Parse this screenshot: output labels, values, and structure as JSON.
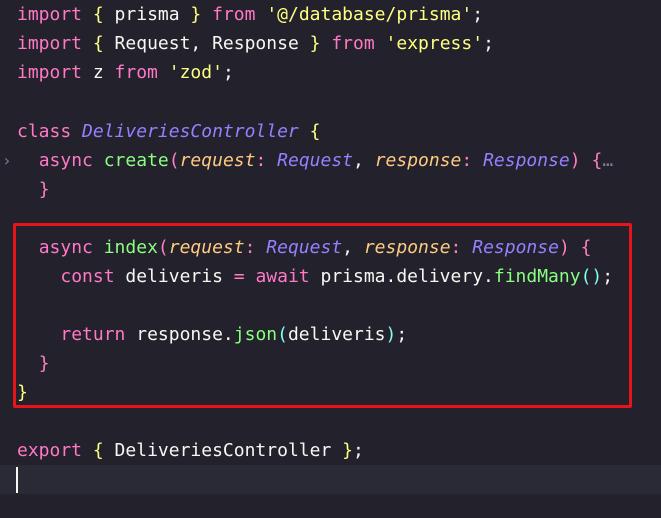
{
  "editor": {
    "lines": [
      {
        "tokens": [
          [
            "kw",
            "import"
          ],
          [
            "plain",
            " "
          ],
          [
            "br1",
            "{"
          ],
          [
            "plain",
            " prisma "
          ],
          [
            "br1",
            "}"
          ],
          [
            "plain",
            " "
          ],
          [
            "kw",
            "from"
          ],
          [
            "plain",
            " "
          ],
          [
            "str",
            "'@/database/prisma'"
          ],
          [
            "plain",
            ";"
          ]
        ]
      },
      {
        "tokens": [
          [
            "kw",
            "import"
          ],
          [
            "plain",
            " "
          ],
          [
            "br1",
            "{"
          ],
          [
            "plain",
            " Request, Response "
          ],
          [
            "br1",
            "}"
          ],
          [
            "plain",
            " "
          ],
          [
            "kw",
            "from"
          ],
          [
            "plain",
            " "
          ],
          [
            "str",
            "'express'"
          ],
          [
            "plain",
            ";"
          ]
        ]
      },
      {
        "tokens": [
          [
            "kw",
            "import"
          ],
          [
            "plain",
            " z "
          ],
          [
            "kw",
            "from"
          ],
          [
            "plain",
            " "
          ],
          [
            "str",
            "'zod'"
          ],
          [
            "plain",
            ";"
          ]
        ]
      },
      {
        "tokens": []
      },
      {
        "tokens": [
          [
            "kw",
            "class"
          ],
          [
            "plain",
            " "
          ],
          [
            "cls",
            "DeliveriesController"
          ],
          [
            "plain",
            " "
          ],
          [
            "br1",
            "{"
          ]
        ]
      },
      {
        "tokens": [
          [
            "plain",
            "  "
          ],
          [
            "kw",
            "async"
          ],
          [
            "plain",
            " "
          ],
          [
            "fn",
            "create"
          ],
          [
            "br2",
            "("
          ],
          [
            "param",
            "request"
          ],
          [
            "op",
            ":"
          ],
          [
            "plain",
            " "
          ],
          [
            "cls",
            "Request"
          ],
          [
            "plain",
            ", "
          ],
          [
            "param",
            "response"
          ],
          [
            "op",
            ":"
          ],
          [
            "plain",
            " "
          ],
          [
            "cls",
            "Response"
          ],
          [
            "br2",
            ")"
          ],
          [
            "plain",
            " "
          ],
          [
            "br2",
            "{"
          ],
          [
            "ellipsis",
            "…"
          ]
        ]
      },
      {
        "tokens": [
          [
            "plain",
            "  "
          ],
          [
            "br2",
            "}"
          ]
        ]
      },
      {
        "tokens": []
      },
      {
        "tokens": [
          [
            "plain",
            "  "
          ],
          [
            "kw",
            "async"
          ],
          [
            "plain",
            " "
          ],
          [
            "fn",
            "index"
          ],
          [
            "br2",
            "("
          ],
          [
            "param",
            "request"
          ],
          [
            "op",
            ":"
          ],
          [
            "plain",
            " "
          ],
          [
            "cls",
            "Request"
          ],
          [
            "plain",
            ", "
          ],
          [
            "param",
            "response"
          ],
          [
            "op",
            ":"
          ],
          [
            "plain",
            " "
          ],
          [
            "cls",
            "Response"
          ],
          [
            "br2",
            ")"
          ],
          [
            "plain",
            " "
          ],
          [
            "br2",
            "{"
          ]
        ]
      },
      {
        "tokens": [
          [
            "plain",
            "    "
          ],
          [
            "kw",
            "const"
          ],
          [
            "plain",
            " deliveris "
          ],
          [
            "op",
            "="
          ],
          [
            "plain",
            " "
          ],
          [
            "kw",
            "await"
          ],
          [
            "plain",
            " prisma.delivery."
          ],
          [
            "fn",
            "findMany"
          ],
          [
            "br3",
            "()"
          ],
          [
            "plain",
            ";"
          ]
        ]
      },
      {
        "tokens": []
      },
      {
        "tokens": [
          [
            "plain",
            "    "
          ],
          [
            "kw",
            "return"
          ],
          [
            "plain",
            " response."
          ],
          [
            "fn",
            "json"
          ],
          [
            "br3",
            "("
          ],
          [
            "plain",
            "deliveris"
          ],
          [
            "br3",
            ")"
          ],
          [
            "plain",
            ";"
          ]
        ]
      },
      {
        "tokens": [
          [
            "plain",
            "  "
          ],
          [
            "br2",
            "}"
          ]
        ]
      },
      {
        "tokens": [
          [
            "br1",
            "}"
          ]
        ]
      },
      {
        "tokens": []
      },
      {
        "tokens": [
          [
            "kw",
            "export"
          ],
          [
            "plain",
            " "
          ],
          [
            "br1",
            "{"
          ],
          [
            "plain",
            " DeliveriesController "
          ],
          [
            "br1",
            "}"
          ],
          [
            "plain",
            ";"
          ]
        ]
      },
      {
        "tokens": []
      }
    ],
    "fold_icon": "chevron-right-icon",
    "fold_line": 5,
    "highlight_color": "#e8141c",
    "background": "#22212c"
  }
}
